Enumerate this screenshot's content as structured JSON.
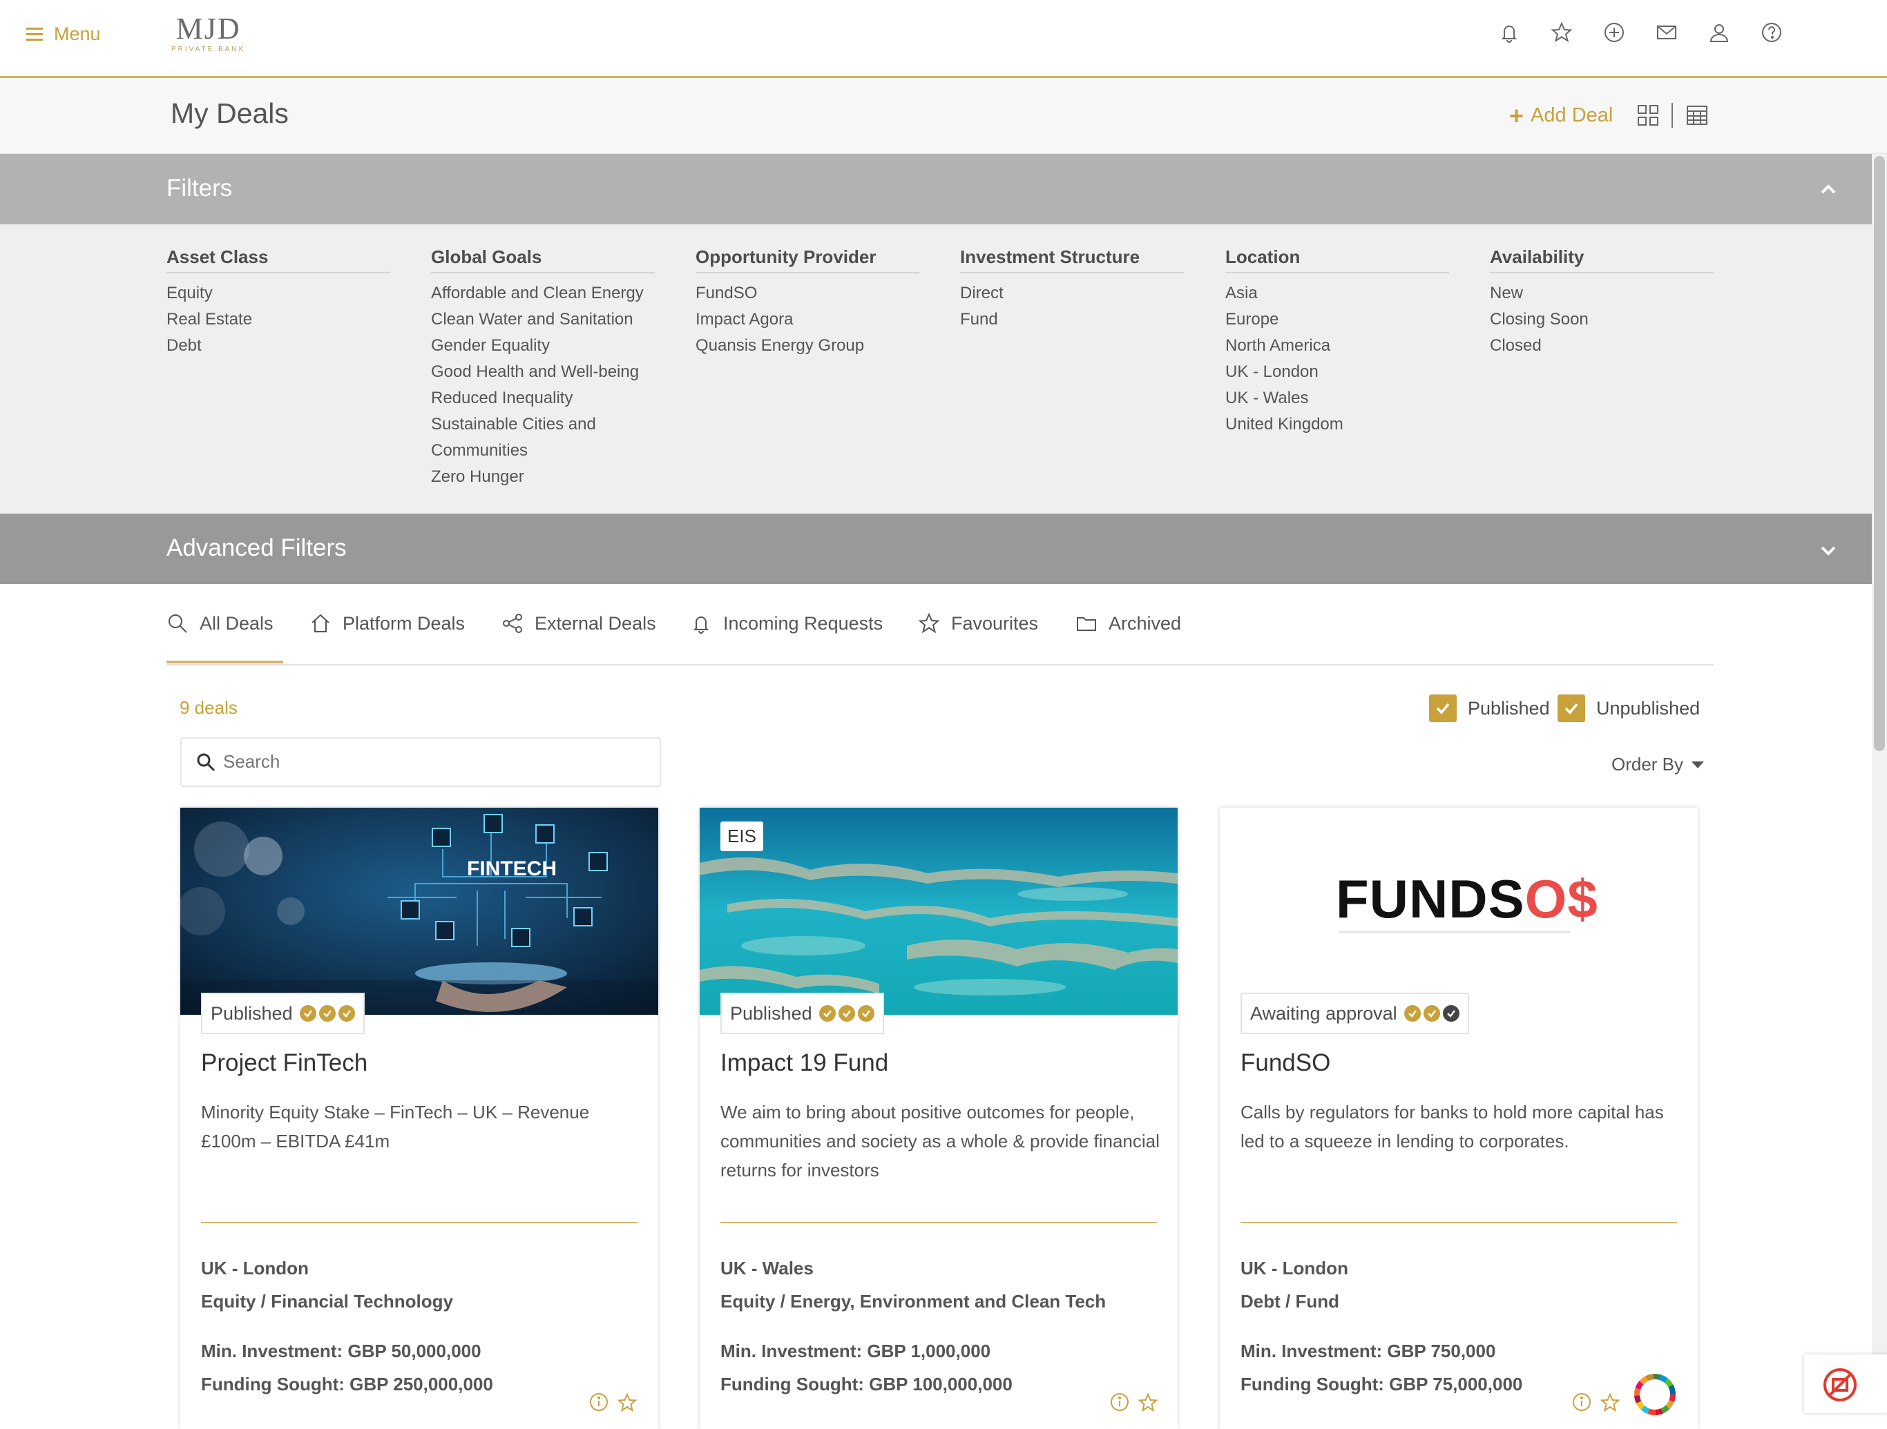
{
  "nav": {
    "menu_label": "Menu",
    "logo_main": "MJD",
    "logo_sub": "PRIVATE BANK",
    "icons": [
      "bell-icon",
      "star-icon",
      "plus-circle-icon",
      "mail-icon",
      "user-icon",
      "help-icon"
    ]
  },
  "header": {
    "title": "My Deals",
    "add_deal_label": "Add Deal"
  },
  "filters": {
    "title": "Filters",
    "columns": [
      {
        "heading": "Asset Class",
        "items": [
          "Equity",
          "Real Estate",
          "Debt"
        ]
      },
      {
        "heading": "Global Goals",
        "items": [
          "Affordable and Clean Energy",
          "Clean Water and Sanitation",
          "Gender Equality",
          "Good Health and Well-being",
          "Reduced Inequality",
          "Sustainable Cities and",
          "Communities",
          "Zero Hunger"
        ]
      },
      {
        "heading": "Opportunity Provider",
        "items": [
          "FundSO",
          "Impact Agora",
          "Quansis Energy Group"
        ]
      },
      {
        "heading": "Investment Structure",
        "items": [
          "Direct",
          "Fund"
        ]
      },
      {
        "heading": "Location",
        "items": [
          "Asia",
          "Europe",
          "North America",
          "UK - London",
          "UK - Wales",
          "United Kingdom"
        ]
      },
      {
        "heading": "Availability",
        "items": [
          "New",
          "Closing Soon",
          "Closed"
        ]
      }
    ],
    "advanced_title": "Advanced Filters"
  },
  "tabs": [
    {
      "label": "All Deals",
      "icon": "search-icon",
      "active": true
    },
    {
      "label": "Platform Deals",
      "icon": "home-icon"
    },
    {
      "label": "External Deals",
      "icon": "share-icon"
    },
    {
      "label": "Incoming Requests",
      "icon": "bell-icon"
    },
    {
      "label": "Favourites",
      "icon": "star-icon"
    },
    {
      "label": "Archived",
      "icon": "folder-icon"
    }
  ],
  "toolbar": {
    "deal_count": "9 deals",
    "published_label": "Published",
    "published_checked": true,
    "unpublished_label": "Unpublished",
    "unpublished_checked": true,
    "search_placeholder": "Search",
    "order_by_label": "Order By"
  },
  "cards": [
    {
      "image_text": "FINTECH",
      "status": "Published",
      "title": "Project FinTech",
      "description": "Minority Equity Stake – FinTech – UK – Revenue £100m – EBITDA £41m",
      "location": "UK - London",
      "category": "Equity / Financial Technology",
      "min_investment": "Min. Investment: GBP 50,000,000",
      "funding_sought": "Funding Sought: GBP 250,000,000"
    },
    {
      "image_tag": "EIS",
      "status": "Published",
      "title": "Impact 19 Fund",
      "description": "We aim to bring about positive outcomes for people, communities and society as a whole & provide financial returns for investors",
      "location": "UK - Wales",
      "category": "Equity / Energy, Environment and Clean Tech",
      "min_investment": "Min. Investment: GBP 1,000,000",
      "funding_sought": "Funding Sought: GBP 100,000,000"
    },
    {
      "logo_text_a": "FUNDS",
      "logo_text_b": "O$",
      "status": "Awaiting approval",
      "title": "FundSO",
      "description": "Calls by regulators for banks to hold more capital has led to a squeeze in lending to corporates.",
      "location": "UK - London",
      "category": "Debt / Fund",
      "min_investment": "Min. Investment: GBP 750,000",
      "funding_sought": "Funding Sought: GBP 75,000,000"
    }
  ],
  "colors": {
    "accent": "#c9a13b",
    "filters_bar": "#b2b2b2",
    "advanced_bar": "#999999",
    "filters_body": "#efefef"
  }
}
